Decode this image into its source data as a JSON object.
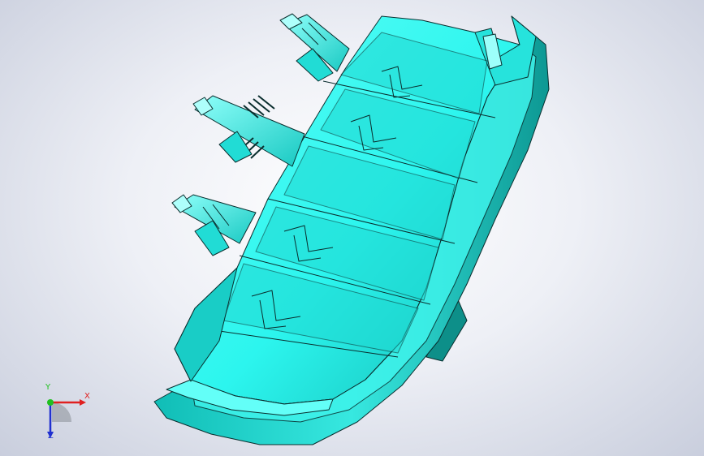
{
  "viewport": {
    "background_top": "#ffffff",
    "background_edge": "#c9cedd"
  },
  "model": {
    "name": "",
    "body_color": "#2cf5ee",
    "shade_color": "#10bdb6",
    "edge_color": "#0a2e2e"
  },
  "triad": {
    "x_label": "X",
    "y_label": "Y",
    "z_label": "Z",
    "x_color": "#e02020",
    "y_color": "#20c020",
    "z_color": "#2030d0"
  }
}
